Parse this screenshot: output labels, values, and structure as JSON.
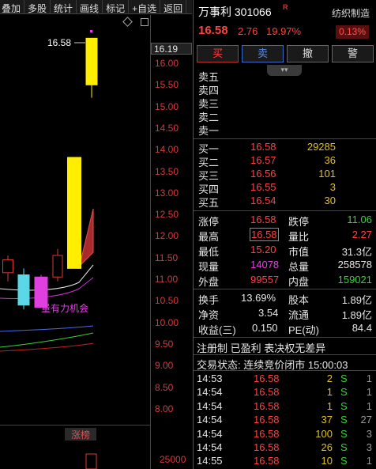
{
  "toolbar": {
    "items": [
      "叠加",
      "多股",
      "统计",
      "画线",
      "标记",
      "+自选",
      "返回"
    ]
  },
  "chart": {
    "price_tag": "16.19",
    "high_label": "16.58",
    "ma_label": "量有力机会",
    "zhangbang_label": "涨榜",
    "volume_label": "25000",
    "y_ticks": [
      "16.00",
      "15.50",
      "15.00",
      "14.50",
      "14.00",
      "13.50",
      "13.00",
      "12.50",
      "12.00",
      "11.50",
      "11.00",
      "10.50",
      "10.00",
      "9.50",
      "9.00",
      "8.50",
      "8.00"
    ],
    "candles": [
      {
        "open": 11.15,
        "close": 11.45,
        "high": 11.55,
        "low": 10.95,
        "color": "#000000",
        "edge": "#d63a3a"
      },
      {
        "open": 10.4,
        "close": 11.1,
        "high": 11.25,
        "low": 10.3,
        "color": "#5ad8e8",
        "edge": "#5ad8e8"
      },
      {
        "open": 10.35,
        "close": 11.05,
        "high": 11.1,
        "low": 10.35,
        "color": "#e040e0",
        "edge": "#e040e0"
      },
      {
        "open": 11.05,
        "close": 11.55,
        "high": 11.7,
        "low": 10.95,
        "color": "#000000",
        "edge": "#d63a3a"
      },
      {
        "open": 11.25,
        "close": 13.82,
        "high": 13.82,
        "low": 11.25,
        "color": "#ffee00",
        "edge": "#ffee00"
      },
      {
        "open": 15.5,
        "close": 16.58,
        "high": 16.58,
        "low": 15.2,
        "color": "#ffee00",
        "edge": "#ffee00"
      }
    ]
  },
  "stock": {
    "name": "万事利 301066",
    "badge": "R",
    "tag": "纺织制造",
    "price": "16.58",
    "change": "2.76",
    "change_pct": "19.97%",
    "tag_pct": "0.13%"
  },
  "actions": {
    "buy": "买",
    "sell": "卖",
    "cancel": "撤",
    "alert": "警",
    "collapse": "▾▾"
  },
  "asks": [
    {
      "label": "卖五",
      "price": "",
      "vol": ""
    },
    {
      "label": "卖四",
      "price": "",
      "vol": ""
    },
    {
      "label": "卖三",
      "price": "",
      "vol": ""
    },
    {
      "label": "卖二",
      "price": "",
      "vol": ""
    },
    {
      "label": "卖一",
      "price": "",
      "vol": ""
    }
  ],
  "bids": [
    {
      "label": "买一",
      "price": "16.58",
      "vol": "29285"
    },
    {
      "label": "买二",
      "price": "16.57",
      "vol": "36"
    },
    {
      "label": "买三",
      "price": "16.56",
      "vol": "101"
    },
    {
      "label": "买四",
      "price": "16.55",
      "vol": "3"
    },
    {
      "label": "买五",
      "price": "16.54",
      "vol": "30"
    }
  ],
  "stats": {
    "limit_up_label": "涨停",
    "limit_up": "16.58",
    "limit_down_label": "跌停",
    "limit_down": "11.06",
    "high_label": "最高",
    "high": "16.58",
    "vol_ratio_label": "量比",
    "vol_ratio": "2.27",
    "low_label": "最低",
    "low": "15.20",
    "mkt_cap_label": "市值",
    "mkt_cap": "31.3亿",
    "cur_vol_label": "现量",
    "cur_vol": "14078",
    "total_vol_label": "总量",
    "total_vol": "258578",
    "outer_label": "外盘",
    "outer": "99557",
    "inner_label": "内盘",
    "inner": "159021",
    "turnover_label": "换手",
    "turnover": "13.69%",
    "shares_label": "股本",
    "shares": "1.89亿",
    "nav_label": "净资",
    "nav": "3.54",
    "float_label": "流通",
    "float": "1.89亿",
    "eps_label": "收益(三)",
    "eps": "0.150",
    "pe_label": "PE(动)",
    "pe": "84.4"
  },
  "notes": {
    "line1": "注册制 已盈利 表决权无差异",
    "line2": "交易状态: 连续竞价闭市 15:00:03"
  },
  "trades": [
    {
      "time": "14:53",
      "price": "16.58",
      "vol": "2",
      "side": "S",
      "count": "1"
    },
    {
      "time": "14:54",
      "price": "16.58",
      "vol": "1",
      "side": "S",
      "count": "1"
    },
    {
      "time": "14:54",
      "price": "16.58",
      "vol": "1",
      "side": "S",
      "count": "1"
    },
    {
      "time": "14:54",
      "price": "16.58",
      "vol": "37",
      "side": "S",
      "count": "27"
    },
    {
      "time": "14:54",
      "price": "16.58",
      "vol": "100",
      "side": "S",
      "count": "3"
    },
    {
      "time": "14:54",
      "price": "16.58",
      "vol": "26",
      "side": "S",
      "count": "3"
    },
    {
      "time": "14:55",
      "price": "16.58",
      "vol": "10",
      "side": "S",
      "count": "1"
    }
  ],
  "colors": {
    "up": "#ff4040",
    "down": "#3ad03a",
    "volume": "#e0c020",
    "limit_up_candle": "#ffee00"
  }
}
